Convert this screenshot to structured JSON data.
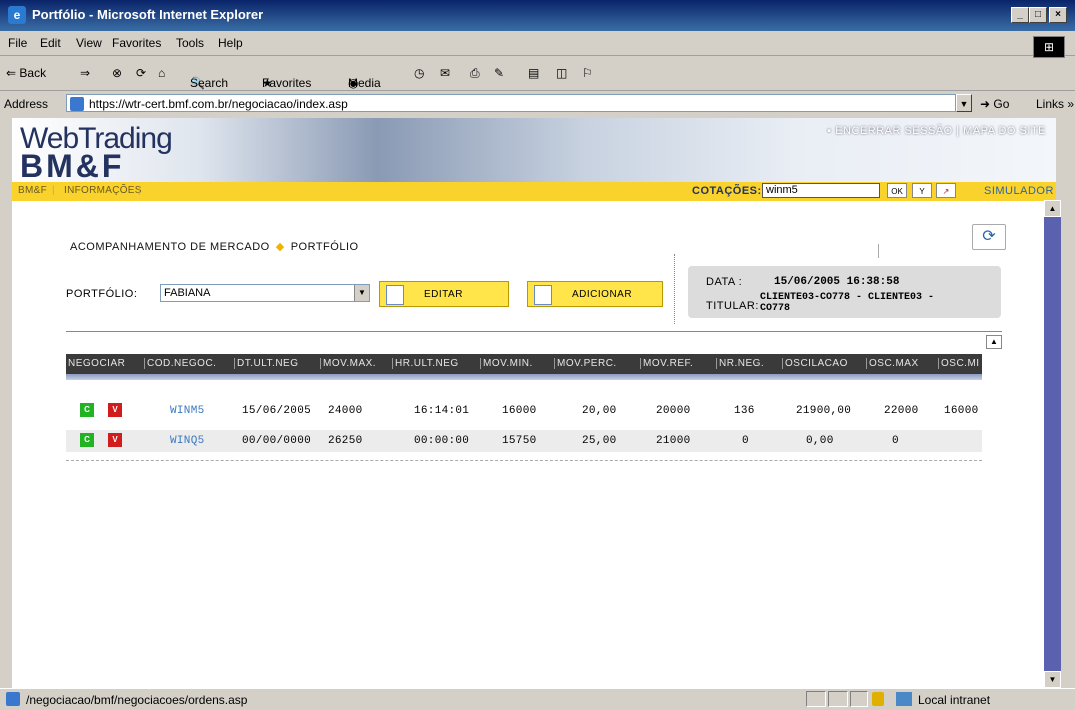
{
  "window": {
    "title": "Portfólio - Microsoft Internet Explorer"
  },
  "menu": [
    "File",
    "Edit",
    "View",
    "Favorites",
    "Tools",
    "Help"
  ],
  "toolbar": {
    "back": "⇐ Back",
    "search": "Search",
    "favorites": "Favorites",
    "media": "Media"
  },
  "address": {
    "label": "Address",
    "url": "https://wtr-cert.bmf.com.br/negociacao/index.asp",
    "go": "Go",
    "links": "Links"
  },
  "banner": {
    "logo_top": "WebTrading",
    "logo_bottom": "BM&F",
    "session": "ENCERRAR SESSÃO | MAPA DO SITE"
  },
  "nav": {
    "bmf": "BM&F",
    "info": "INFORMAÇÕES",
    "quotes_label": "COTAÇÕES:",
    "quotes_value": "winm5",
    "ok": "OK",
    "simulador": "SIMULADOR"
  },
  "breadcrumb": {
    "part1": "ACOMPANHAMENTO DE MERCADO",
    "part2": "PORTFÓLIO"
  },
  "portfolio": {
    "label": "PORTFÓLIO:",
    "selected": "FABIANA",
    "edit": "EDITAR",
    "add": "ADICIONAR"
  },
  "info": {
    "date_label": "DATA :",
    "date_value": "15/06/2005 16:38:58",
    "holder_label": "TITULAR:",
    "holder_value_1": "CLIENTE03-CO778 - CLIENTE03 -",
    "holder_value_2": "CO778"
  },
  "grid": {
    "headers": [
      "NEGOCIAR",
      "COD.NEGOC.",
      "DT.ULT.NEG",
      "MOV.MAX.",
      "HR.ULT.NEG",
      "MOV.MIN.",
      "MOV.PERC.",
      "MOV.REF.",
      "NR.NEG.",
      "OSCILACAO",
      "OSC.MAX",
      "OSC.MI"
    ],
    "rows": [
      {
        "c": "C",
        "v": "V",
        "code": "WINM5",
        "dt": "15/06/2005",
        "max": "24000",
        "hr": "16:14:01",
        "min": "16000",
        "perc": "20,00",
        "ref": "20000",
        "nr": "136",
        "osc": "21900,00",
        "oscmax": "22000",
        "oscmin": "16000"
      },
      {
        "c": "C",
        "v": "V",
        "code": "WINQ5",
        "dt": "00/00/0000",
        "max": "26250",
        "hr": "00:00:00",
        "min": "15750",
        "perc": "25,00",
        "ref": "21000",
        "nr": "0",
        "osc": "0,00",
        "oscmax": "0",
        "oscmin": ""
      }
    ]
  },
  "status": {
    "text": "/negociacao/bmf/negociacoes/ordens.asp",
    "zone": "Local intranet"
  },
  "colors": {
    "nav_yellow": "#fad22c",
    "grid_header": "#3a3a3a",
    "link_blue": "#3a78c0"
  }
}
